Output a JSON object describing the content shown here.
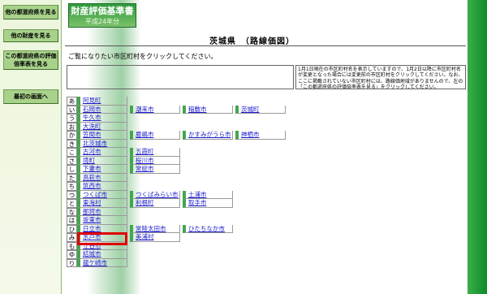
{
  "nav": {
    "buttons": [
      {
        "label": "他の都道府県を見る"
      },
      {
        "label": "他の財産を見る"
      },
      {
        "label": "この都道府県の評価倍率表を見る"
      },
      {
        "label": "最初の画面へ"
      }
    ]
  },
  "header": {
    "title": "財産評価基準書",
    "subtitle": "平成24年分"
  },
  "page": {
    "heading": "茨城県　（路線価図）",
    "instruction": "ご覧になりたい市区町村をクリックしてください。",
    "note": "1月1日現在の市区町村名を表示していますので、1月2日以降に市区町村名が変更となった場合には変更前の市区町村をクリックしてください。なお、ここに掲載されていない市区町村には、路線価地域がありませんので、左の「この都道府県の評価倍率表を見る」をクリックしてください。"
  },
  "index": [
    {
      "kana": "あ",
      "cities": [
        "阿見町"
      ]
    },
    {
      "kana": "い",
      "cities": [
        "石岡市",
        "潮来市",
        "稲敷市",
        "茨城町"
      ]
    },
    {
      "kana": "う",
      "cities": [
        "牛久市"
      ]
    },
    {
      "kana": "お",
      "cities": [
        "大洗町"
      ]
    },
    {
      "kana": "か",
      "cities": [
        "笠間市",
        "鹿嶋市",
        "かすみがうら市",
        "神栖市"
      ]
    },
    {
      "kana": "き",
      "cities": [
        "北茨城市"
      ]
    },
    {
      "kana": "こ",
      "cities": [
        "古河市",
        "五霞町"
      ]
    },
    {
      "kana": "さ",
      "cities": [
        "境町",
        "桜川市"
      ]
    },
    {
      "kana": "し",
      "cities": [
        "下妻市",
        "常総市"
      ]
    },
    {
      "kana": "た",
      "cities": [
        "高萩市"
      ]
    },
    {
      "kana": "ち",
      "cities": [
        "筑西市"
      ]
    },
    {
      "kana": "つ",
      "cities": [
        "つくば市",
        "つくばみらい市",
        "土浦市"
      ]
    },
    {
      "kana": "と",
      "cities": [
        "東海村",
        "利根町",
        "取手市"
      ]
    },
    {
      "kana": "な",
      "cities": [
        "那珂市"
      ]
    },
    {
      "kana": "は",
      "cities": [
        "坂東市"
      ]
    },
    {
      "kana": "ひ",
      "cities": [
        "日立市",
        "常陸太田市",
        "ひたちなか市"
      ]
    },
    {
      "kana": "み",
      "cities": [
        "水戸市",
        "美浦村"
      ]
    },
    {
      "kana": "も",
      "cities": [
        "守谷市"
      ]
    },
    {
      "kana": "ゆ",
      "cities": [
        "結城市"
      ]
    },
    {
      "kana": "り",
      "cities": [
        "龍ケ崎市"
      ]
    }
  ],
  "colors": {
    "accent_green": "#43a64f",
    "link_blue": "#1a1acc",
    "highlight_red": "#e00000"
  }
}
